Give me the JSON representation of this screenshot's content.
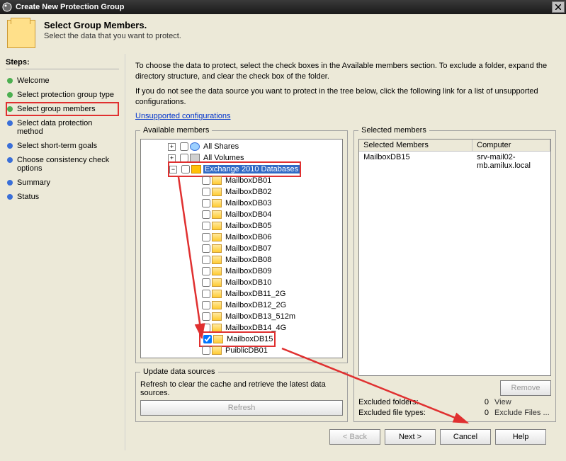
{
  "window": {
    "title": "Create New Protection Group"
  },
  "header": {
    "title": "Select Group Members.",
    "subtitle": "Select the data that you want to protect."
  },
  "steps": {
    "heading": "Steps:",
    "items": [
      {
        "label": "Welcome",
        "state": "done"
      },
      {
        "label": "Select protection group type",
        "state": "done"
      },
      {
        "label": "Select group members",
        "state": "current",
        "highlighted": true
      },
      {
        "label": "Select data protection method",
        "state": "pending"
      },
      {
        "label": "Select short-term goals",
        "state": "pending"
      },
      {
        "label": "Choose consistency check options",
        "state": "pending"
      },
      {
        "label": "Summary",
        "state": "pending"
      },
      {
        "label": "Status",
        "state": "pending"
      }
    ]
  },
  "main": {
    "instruction1": "To choose the data to protect, select the check boxes in the Available members section. To exclude a folder, expand the directory structure, and clear the check box of the folder.",
    "instruction2": "If you do not see the data source you want to protect in the tree below, click the following link for a list of unsupported configurations.",
    "unsupported_link": "Unsupported configurations",
    "available_legend": "Available members",
    "tree": {
      "all_shares": "All Shares",
      "all_volumes": "All Volumes",
      "exchange_root": "Exchange 2010 Databases",
      "databases": [
        "MailboxDB01",
        "MailboxDB02",
        "MailboxDB03",
        "MailboxDB04",
        "MailboxDB05",
        "MailboxDB06",
        "MailboxDB07",
        "MailboxDB08",
        "MailboxDB09",
        "MailboxDB10",
        "MailboxDB11_2G",
        "MailboxDB12_2G",
        "MailboxDB13_512m",
        "MailboxDB14_4G",
        "MailboxDB15",
        "PuiblicDB01"
      ],
      "checked_db": "MailboxDB15"
    },
    "update": {
      "legend": "Update data sources",
      "text": "Refresh to clear the cache and retrieve the latest data sources.",
      "refresh": "Refresh"
    },
    "selected": {
      "legend": "Selected members",
      "col_members": "Selected Members",
      "col_computer": "Computer",
      "rows": [
        {
          "member": "MailboxDB15",
          "computer": "srv-mail02-mb.amilux.local"
        }
      ],
      "remove": "Remove",
      "excluded_folders_label": "Excluded folders:",
      "excluded_folders_count": "0",
      "excluded_folders_action": "View",
      "excluded_types_label": "Excluded file types:",
      "excluded_types_count": "0",
      "excluded_types_action": "Exclude Files ..."
    }
  },
  "buttons": {
    "back": "< Back",
    "next": "Next >",
    "cancel": "Cancel",
    "help": "Help"
  }
}
